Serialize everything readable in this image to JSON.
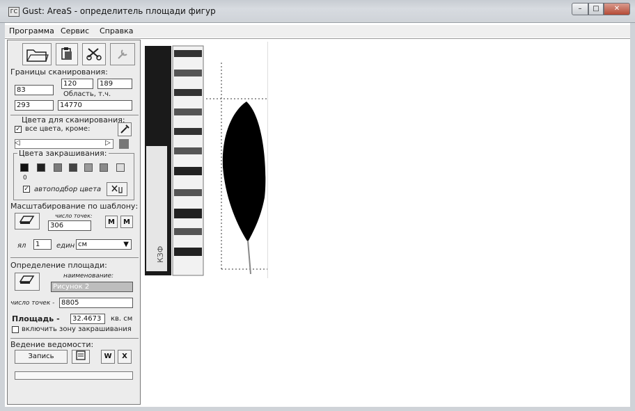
{
  "window": {
    "title": "Gust: AreaS - определитель площади фигур",
    "icon_text": "ГС"
  },
  "menu": [
    "Программа",
    "Сервис",
    "Справка"
  ],
  "scan_bounds": {
    "heading": "Границы сканирования:",
    "top": "120",
    "right": "189",
    "left": "83",
    "bottom": "293",
    "area_label": "Область, т.ч.",
    "area_value": "14770"
  },
  "scan_colors": {
    "heading": "Цвета для сканирования:",
    "all_colors_label": "все цвета, кроме:",
    "all_colors_checked": true
  },
  "fill_colors": {
    "heading": "Цвета закрашивания:",
    "swatches": [
      "#111111",
      "#222222",
      "#7b7b7b",
      "#444444",
      "#9a9a9a",
      "#8a8a8a",
      "#dddddd"
    ],
    "small_value": "0",
    "auto_label": "автоподбор цвета",
    "auto_checked": true
  },
  "scaling": {
    "heading": "Масштабирование по шаблону:",
    "points_label": "число точек:",
    "points_value": "306",
    "len_label": "ял",
    "len_value": "1",
    "unit_label": "един",
    "unit_value": "см"
  },
  "area": {
    "heading": "Определение площади:",
    "name_label": "наименование:",
    "name_value": "Рисунок 2",
    "points_label": "число точек -",
    "points_value": "8805",
    "result_label": "Площадь -",
    "result_value": "32.4673",
    "unit": "кв. см",
    "zone_label": "включить зону закрашивания",
    "zone_checked": false
  },
  "records": {
    "heading": "Ведение ведомости:",
    "record_button": "Запись"
  },
  "colors": {
    "panel": "#ececec",
    "leaf": "#000000",
    "stem": "#888888"
  }
}
